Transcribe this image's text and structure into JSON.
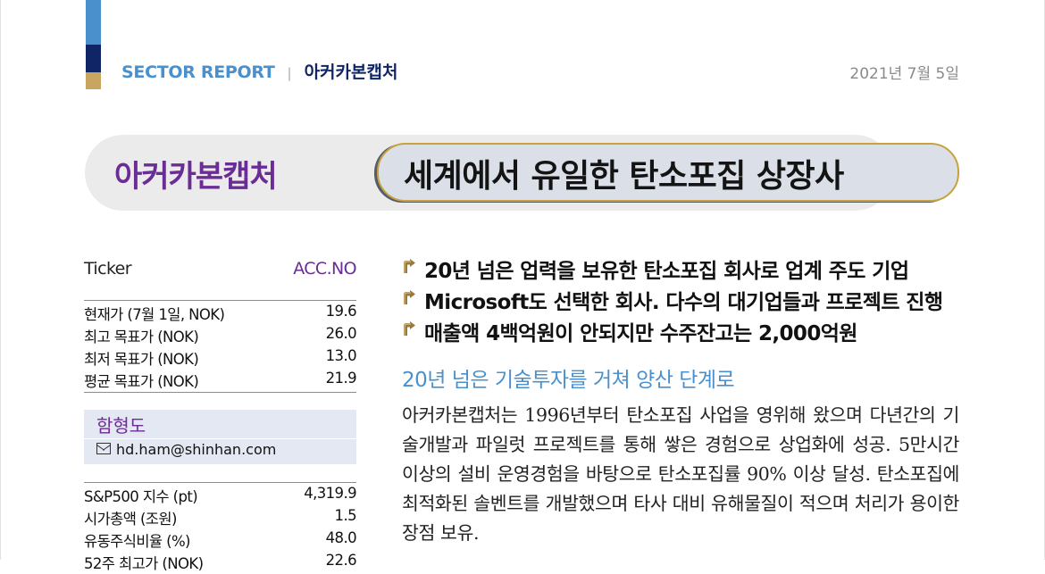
{
  "header": {
    "report_label": "SECTOR REPORT",
    "separator": "|",
    "company": "아커카본캡처",
    "date": "2021년 7월 5일"
  },
  "banner": {
    "company": "아커카본캡처",
    "headline": "세계에서 유일한 탄소포집 상장사"
  },
  "sidebar": {
    "ticker_label": "Ticker",
    "ticker_value": "ACC.NO",
    "price_table": [
      {
        "label": "현재가 (7월 1일, NOK)",
        "value": "19.6"
      },
      {
        "label": "최고 목표가 (NOK)",
        "value": "26.0"
      },
      {
        "label": "최저 목표가 (NOK)",
        "value": "13.0"
      },
      {
        "label": "평균 목표가 (NOK)",
        "value": "21.9"
      }
    ],
    "analyst_name": "함형도",
    "analyst_email": "hd.ham@shinhan.com",
    "market_table": [
      {
        "label": "S&P500 지수 (pt)",
        "value": "4,319.9"
      },
      {
        "label": "시가총액 (조원)",
        "value": "1.5"
      },
      {
        "label": "유동주식비율 (%)",
        "value": "48.0"
      },
      {
        "label": "52주 최고가 (NOK)",
        "value": "22.6"
      }
    ]
  },
  "bullets": [
    "20년 넘은 업력을 보유한 탄소포집 회사로 업계 주도 기업",
    "Microsoft도 선택한 회사. 다수의 대기업들과 프로젝트 진행",
    "매출액 4백억원이 안되지만 수주잔고는 2,000억원"
  ],
  "section_title": "20년 넘은 기술투자를 거쳐 양산 단계로",
  "body_text": "아커카본캡처는 1996년부터 탄소포집 사업을 영위해 왔으며 다년간의 기술개발과 파일럿 프로젝트를 통해 쌓은 경험으로 상업화에 성공. 5만시간 이상의 설비 운영경험을 바탕으로 탄소포집률 90% 이상 달성. 탄소포집에 최적화된 솔벤트를 개발했으며 타사 대비 유해물질이 적으며 처리가 용이한 장점 보유.",
  "colors": {
    "accent_blue": "#4a90cc",
    "navy": "#0f2566",
    "gold": "#c9a562",
    "purple": "#6a2c95"
  },
  "icons": {
    "bullet": "arrow-bullet-icon",
    "email": "envelope-icon"
  }
}
